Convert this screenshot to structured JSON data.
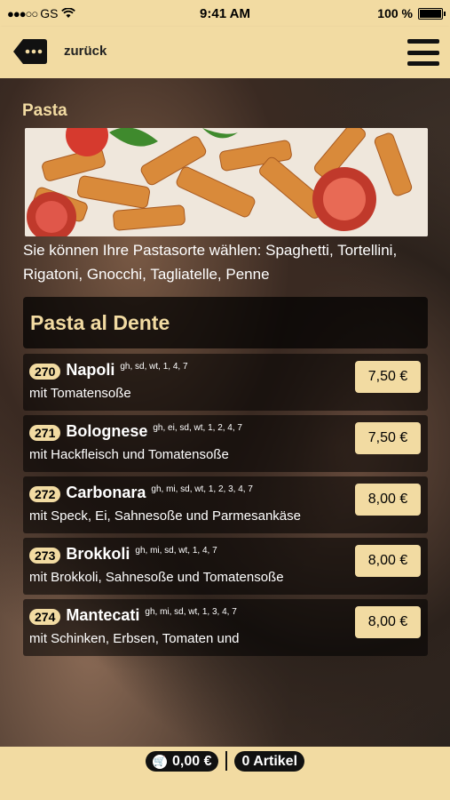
{
  "status_bar": {
    "carrier": "GS",
    "time": "9:41 AM",
    "battery": "100 %"
  },
  "nav": {
    "back_label": "zurück"
  },
  "section": {
    "title": "Pasta",
    "description": "Sie können Ihre Pastasorte wählen: Spaghetti, Tortellini, Rigatoni, Gnocchi, Tagliatelle, Penne"
  },
  "category": {
    "title": "Pasta al Dente"
  },
  "items": [
    {
      "number": "270",
      "name": "Napoli",
      "tags": "gh, sd, wt, 1, 4, 7",
      "description": "mit Tomatensoße",
      "price": "7,50 €"
    },
    {
      "number": "271",
      "name": "Bolognese",
      "tags": "gh, ei, sd, wt, 1, 2, 4, 7",
      "description": "mit Hackfleisch und Tomatensoße",
      "price": "7,50 €"
    },
    {
      "number": "272",
      "name": "Carbonara",
      "tags": "gh, mi, sd, wt, 1, 2, 3, 4, 7",
      "description": "mit Speck, Ei, Sahnesoße und Parmesankäse",
      "price": "8,00 €"
    },
    {
      "number": "273",
      "name": "Brokkoli",
      "tags": "gh, mi, sd, wt, 1, 4, 7",
      "description": "mit Brokkoli, Sahnesoße und Tomatensoße",
      "price": "8,00 €"
    },
    {
      "number": "274",
      "name": "Mantecati",
      "tags": "gh, mi, sd, wt, 1, 3, 4, 7",
      "description": "mit Schinken, Erbsen, Tomaten und",
      "price": "8,00 €"
    }
  ],
  "cart": {
    "total": "0,00 €",
    "articles": "0 Artikel"
  },
  "colors": {
    "accent": "#f2dba2",
    "dark": "#111111"
  }
}
